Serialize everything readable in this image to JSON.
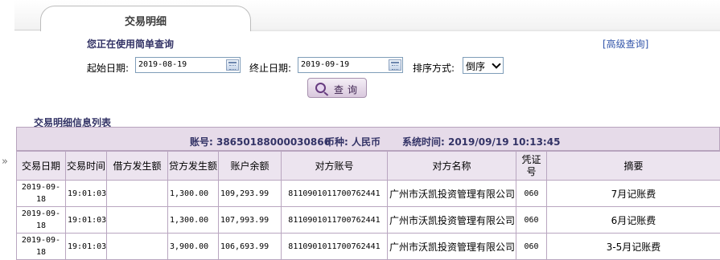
{
  "tab": {
    "title": "交易明细"
  },
  "side_arrow": "»",
  "subtitle": "您正在使用简单查询",
  "advanced_link": "[高级查询]",
  "form": {
    "start_label": "起始日期:",
    "start_value": "2019-08-19",
    "end_label": "终止日期:",
    "end_value": "2019-09-19",
    "sort_label": "排序方式:",
    "sort_value": "倒序",
    "query_label": "查询"
  },
  "list_title": "交易明细信息列表",
  "info": {
    "account": "账号: 38650188000030866",
    "currency": "币种: 人民币",
    "system_time": "系统时间: 2019/09/19 10:13:45"
  },
  "table": {
    "headers": [
      "交易日期",
      "交易时间",
      "借方发生额",
      "贷方发生额",
      "账户余额",
      "对方账号",
      "对方名称",
      "凭证号",
      "摘要"
    ],
    "rows": [
      [
        "2019-09-18",
        "19:01:03",
        "",
        "1,300.00",
        "109,293.99",
        "8110901011700762441",
        "广州市沃凯投资管理有限公司",
        "060",
        "7月记账费"
      ],
      [
        "2019-09-18",
        "19:01:03",
        "",
        "1,300.00",
        "107,993.99",
        "8110901011700762441",
        "广州市沃凯投资管理有限公司",
        "060",
        "6月记账费"
      ],
      [
        "2019-09-18",
        "19:01:03",
        "",
        "3,900.00",
        "106,693.99",
        "8110901011700762441",
        "广州市沃凯投资管理有限公司",
        "060",
        "3-5月记账费"
      ]
    ]
  }
}
